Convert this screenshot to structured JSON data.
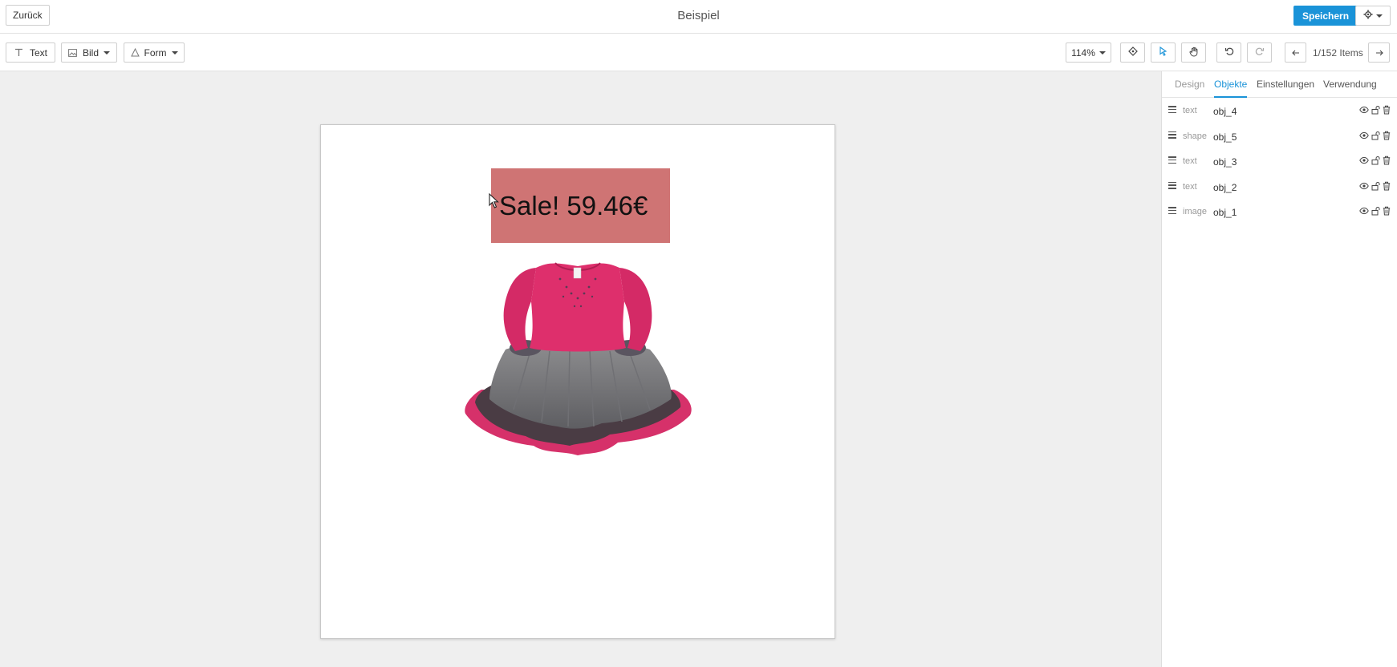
{
  "header": {
    "back_label": "Zurück",
    "title": "Beispiel",
    "save_label": "Speichern"
  },
  "toolbar": {
    "text_label": "Text",
    "image_label": "Bild",
    "shape_label": "Form",
    "zoom": "114%",
    "page_info": "1/152 Items"
  },
  "canvas": {
    "sale_text": "Sale! 59.46€",
    "sale_box_color": "#cf7474"
  },
  "panel": {
    "tabs": [
      {
        "label": "Design"
      },
      {
        "label": "Objekte"
      },
      {
        "label": "Einstellungen"
      },
      {
        "label": "Verwendung"
      }
    ],
    "active_tab": "Objekte",
    "objects": [
      {
        "type": "text",
        "name": "obj_4"
      },
      {
        "type": "shape",
        "name": "obj_5"
      },
      {
        "type": "text",
        "name": "obj_3"
      },
      {
        "type": "text",
        "name": "obj_2"
      },
      {
        "type": "image",
        "name": "obj_1"
      }
    ]
  },
  "colors": {
    "accent": "#1a93d8",
    "workspace_bg": "#efefef"
  }
}
